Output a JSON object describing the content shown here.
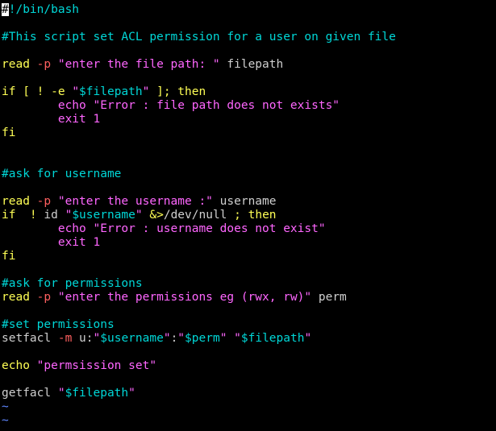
{
  "theme": {
    "background": "#000000",
    "comment_color": "#00d7d7",
    "keyword_color": "#ffff55",
    "string_color": "#ff66ff",
    "flag_color": "#ff5f5f",
    "tilde_color": "#5f87ff"
  },
  "editor": {
    "lines": [
      {
        "tokens": [
          {
            "text": "#",
            "cls": "c-shebang cursor-cell"
          },
          {
            "text": "!/bin/bash",
            "cls": "c-shebang"
          }
        ]
      },
      {
        "tokens": []
      },
      {
        "tokens": [
          {
            "text": "#This script set ACL permission for a user on given file",
            "cls": "c-comment"
          }
        ]
      },
      {
        "tokens": []
      },
      {
        "tokens": [
          {
            "text": "read ",
            "cls": "c-keyword"
          },
          {
            "text": "-p",
            "cls": "c-flag"
          },
          {
            "text": " ",
            "cls": "c-plain"
          },
          {
            "text": "\"enter the file path: \"",
            "cls": "c-string"
          },
          {
            "text": " filepath",
            "cls": "c-plain"
          }
        ]
      },
      {
        "tokens": []
      },
      {
        "tokens": [
          {
            "text": "if [ ! -e ",
            "cls": "c-keyword"
          },
          {
            "text": "\"",
            "cls": "c-string"
          },
          {
            "text": "$filepath",
            "cls": "c-var"
          },
          {
            "text": "\"",
            "cls": "c-string"
          },
          {
            "text": " ]; then",
            "cls": "c-keyword"
          }
        ]
      },
      {
        "tokens": [
          {
            "text": "        ",
            "cls": "c-plain"
          },
          {
            "text": "echo ",
            "cls": "c-echo"
          },
          {
            "text": "\"Error : file path does not exists\"",
            "cls": "c-string"
          }
        ]
      },
      {
        "tokens": [
          {
            "text": "        ",
            "cls": "c-plain"
          },
          {
            "text": "exit ",
            "cls": "c-echo"
          },
          {
            "text": "1",
            "cls": "c-number"
          }
        ]
      },
      {
        "tokens": [
          {
            "text": "fi",
            "cls": "c-keyword"
          }
        ]
      },
      {
        "tokens": []
      },
      {
        "tokens": []
      },
      {
        "tokens": [
          {
            "text": "#ask for username",
            "cls": "c-comment"
          }
        ]
      },
      {
        "tokens": []
      },
      {
        "tokens": [
          {
            "text": "read ",
            "cls": "c-keyword"
          },
          {
            "text": "-p",
            "cls": "c-flag"
          },
          {
            "text": " ",
            "cls": "c-plain"
          },
          {
            "text": "\"enter the username :\"",
            "cls": "c-string"
          },
          {
            "text": " username",
            "cls": "c-plain"
          }
        ]
      },
      {
        "tokens": [
          {
            "text": "if  ! ",
            "cls": "c-keyword"
          },
          {
            "text": "id ",
            "cls": "c-cmd"
          },
          {
            "text": "\"",
            "cls": "c-string"
          },
          {
            "text": "$username",
            "cls": "c-var"
          },
          {
            "text": "\"",
            "cls": "c-string"
          },
          {
            "text": " ",
            "cls": "c-plain"
          },
          {
            "text": "&>",
            "cls": "c-keyword"
          },
          {
            "text": "/dev/null ",
            "cls": "c-plain"
          },
          {
            "text": "; then",
            "cls": "c-keyword"
          }
        ]
      },
      {
        "tokens": [
          {
            "text": "        ",
            "cls": "c-plain"
          },
          {
            "text": "echo ",
            "cls": "c-echo"
          },
          {
            "text": "\"Error : username does not exist\"",
            "cls": "c-string"
          }
        ]
      },
      {
        "tokens": [
          {
            "text": "        ",
            "cls": "c-plain"
          },
          {
            "text": "exit ",
            "cls": "c-echo"
          },
          {
            "text": "1",
            "cls": "c-number"
          }
        ]
      },
      {
        "tokens": [
          {
            "text": "fi",
            "cls": "c-keyword"
          }
        ]
      },
      {
        "tokens": []
      },
      {
        "tokens": [
          {
            "text": "#ask for permissions",
            "cls": "c-comment"
          }
        ]
      },
      {
        "tokens": [
          {
            "text": "read ",
            "cls": "c-keyword"
          },
          {
            "text": "-p",
            "cls": "c-flag"
          },
          {
            "text": " ",
            "cls": "c-plain"
          },
          {
            "text": "\"enter the permissions eg (rwx, rw)\"",
            "cls": "c-string"
          },
          {
            "text": " perm",
            "cls": "c-plain"
          }
        ]
      },
      {
        "tokens": []
      },
      {
        "tokens": [
          {
            "text": "#set permissions",
            "cls": "c-comment"
          }
        ]
      },
      {
        "tokens": [
          {
            "text": "setfacl ",
            "cls": "c-cmd"
          },
          {
            "text": "-m",
            "cls": "c-flag"
          },
          {
            "text": " u:",
            "cls": "c-plain"
          },
          {
            "text": "\"",
            "cls": "c-string"
          },
          {
            "text": "$username",
            "cls": "c-var"
          },
          {
            "text": "\"",
            "cls": "c-string"
          },
          {
            "text": ":",
            "cls": "c-plain"
          },
          {
            "text": "\"",
            "cls": "c-string"
          },
          {
            "text": "$perm",
            "cls": "c-var"
          },
          {
            "text": "\"",
            "cls": "c-string"
          },
          {
            "text": " ",
            "cls": "c-plain"
          },
          {
            "text": "\"",
            "cls": "c-string"
          },
          {
            "text": "$filepath",
            "cls": "c-var"
          },
          {
            "text": "\"",
            "cls": "c-string"
          }
        ]
      },
      {
        "tokens": []
      },
      {
        "tokens": [
          {
            "text": "echo ",
            "cls": "c-keyword"
          },
          {
            "text": "\"permsission set\"",
            "cls": "c-string"
          }
        ]
      },
      {
        "tokens": []
      },
      {
        "tokens": [
          {
            "text": "getfacl ",
            "cls": "c-cmd"
          },
          {
            "text": "\"",
            "cls": "c-string"
          },
          {
            "text": "$filepath",
            "cls": "c-var"
          },
          {
            "text": "\"",
            "cls": "c-string"
          }
        ]
      },
      {
        "tokens": [
          {
            "text": "~",
            "cls": "c-tilde"
          }
        ]
      },
      {
        "tokens": [
          {
            "text": "~",
            "cls": "c-tilde"
          }
        ]
      }
    ]
  }
}
